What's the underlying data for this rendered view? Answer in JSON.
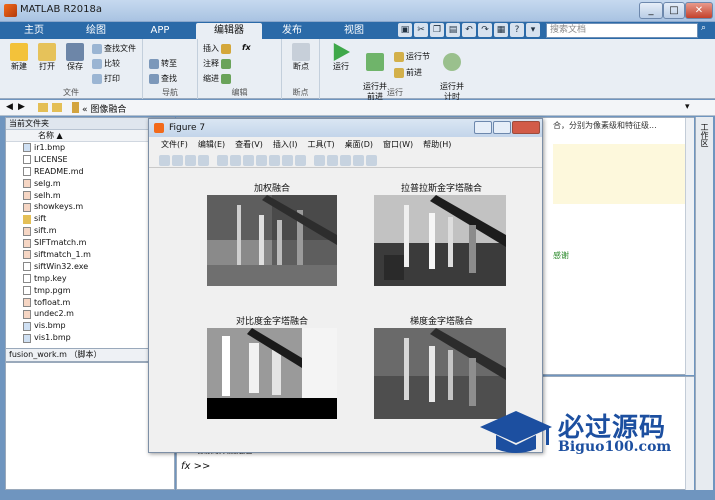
{
  "window": {
    "title": "MATLAB R2018a",
    "min": "_",
    "max": "□",
    "close": "✕"
  },
  "tabs": [
    {
      "label": "主页"
    },
    {
      "label": "绘图"
    },
    {
      "label": "APP"
    },
    {
      "label": "编辑器"
    },
    {
      "label": "发布"
    },
    {
      "label": "视图"
    }
  ],
  "doc_search": {
    "placeholder": "搜索文档"
  },
  "ribbon": {
    "file": {
      "label": "文件",
      "new": "新建",
      "open": "打开",
      "save": "保存",
      "find_files": "查找文件",
      "compare": "比较",
      "print": "打印"
    },
    "nav": {
      "label": "导航",
      "goto": "转至",
      "find": "查找"
    },
    "edit": {
      "label": "编辑",
      "insert": "插入",
      "comment": "注释",
      "indent": "缩进",
      "fx": "fx"
    },
    "breakpoints": {
      "label": "断点",
      "bp": "断点"
    },
    "run": {
      "label": "运行",
      "run": "运行",
      "run_advance": "运行并\n前进",
      "run_section": "运行节",
      "advance": "前进",
      "run_time": "运行并\n计时"
    }
  },
  "path": {
    "crumb": "图像融合"
  },
  "current_folder": {
    "header": "当前文件夹",
    "col_name": "名称",
    "files": [
      "ir1.bmp",
      "LICENSE",
      "README.md",
      "selg.m",
      "selh.m",
      "showkeys.m",
      "sift",
      "sift.m",
      "SIFTmatch.m",
      "siftmatch_1.m",
      "siftWin32.exe",
      "tmp.key",
      "tmp.pgm",
      "tofloat.m",
      "undec2.m",
      "vis.bmp",
      "vis1.bmp"
    ],
    "footer": "fusion_work.m （脚本）"
  },
  "editor": {
    "snippet": "合，分别为像素级和特征级...",
    "line2": "感谢"
  },
  "cmd": {
    "prompt": "fx >>",
    "partial": "像素级灰度融合"
  },
  "figure": {
    "title": "Figure 7",
    "menu": [
      "文件(F)",
      "编辑(E)",
      "查看(V)",
      "插入(I)",
      "工具(T)",
      "桌面(D)",
      "窗口(W)",
      "帮助(H)"
    ],
    "plots": [
      {
        "title": "加权融合"
      },
      {
        "title": "拉普拉斯金字塔融合"
      },
      {
        "title": "对比度金字塔融合"
      },
      {
        "title": "梯度金字塔融合"
      }
    ]
  },
  "right_strip": {
    "label": "工作区"
  },
  "watermark": {
    "cn": "必过源码",
    "en": "Biguo100.com"
  },
  "colors": {
    "tab_bar": "#2b6aa8",
    "ribbon": "#e9eef4",
    "watermark": "#1c4fa0",
    "highlight": "#fdf8dc"
  }
}
